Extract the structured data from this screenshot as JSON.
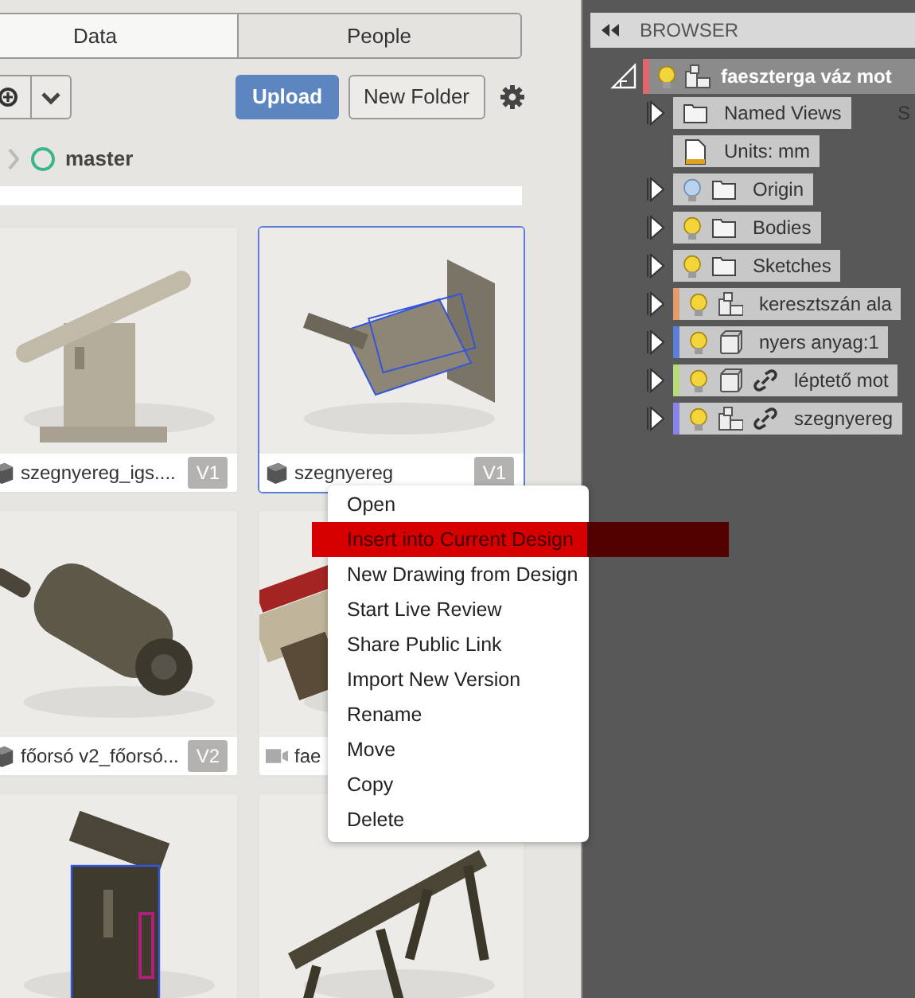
{
  "tabs": [
    {
      "label": "Data",
      "selected": true
    },
    {
      "label": "People",
      "selected": false
    }
  ],
  "toolbar": {
    "upload": "Upload",
    "new_folder": "New Folder"
  },
  "breadcrumb": {
    "branch": "master"
  },
  "cards": [
    {
      "name": "szegnyereg_igs....",
      "version": "V1",
      "kind": "design",
      "selected": false
    },
    {
      "name": "szegnyereg",
      "version": "V1",
      "kind": "design",
      "selected": true
    },
    {
      "name": "főorsó v2_főorsó...",
      "version": "V2",
      "kind": "design",
      "selected": false
    },
    {
      "name": "fae",
      "kind": "animation",
      "selected": false
    },
    {
      "selected": false
    },
    {
      "selected": false
    }
  ],
  "context_menu": [
    {
      "label": "Open",
      "selected": false
    },
    {
      "label": "Insert into Current Design",
      "selected": true
    },
    {
      "label": "New Drawing from Design",
      "selected": false
    },
    {
      "label": "Start Live Review",
      "selected": false
    },
    {
      "label": "Share Public Link",
      "selected": false
    },
    {
      "label": "Import New Version",
      "selected": false
    },
    {
      "label": "Rename",
      "selected": false
    },
    {
      "label": "Move",
      "selected": false
    },
    {
      "label": "Copy",
      "selected": false
    },
    {
      "label": "Delete",
      "selected": false
    }
  ],
  "browser": {
    "title": "BROWSER",
    "behind_text": "S",
    "root": {
      "label": "faeszterga váz mot",
      "color": "#e0666e",
      "visible": true,
      "children": [
        {
          "kind": "folder",
          "label": "Named Views",
          "expandable": true
        },
        {
          "kind": "units",
          "label": "Units: mm",
          "expandable": false
        },
        {
          "kind": "folder",
          "label": "Origin",
          "expandable": true,
          "visible": false
        },
        {
          "kind": "folder",
          "label": "Bodies",
          "expandable": true,
          "visible": true
        },
        {
          "kind": "folder",
          "label": "Sketches",
          "expandable": true,
          "visible": true
        },
        {
          "kind": "component",
          "label": "keresztszán ala",
          "expandable": true,
          "visible": true,
          "color": "#e39a6d",
          "linked": false
        },
        {
          "kind": "body",
          "label": "nyers anyag:1",
          "expandable": true,
          "visible": true,
          "color": "#5b7fd6",
          "linked": false
        },
        {
          "kind": "body",
          "label": "léptető mot",
          "expandable": true,
          "visible": true,
          "color": "#b7da7a",
          "linked": true
        },
        {
          "kind": "component",
          "label": "szegnyereg",
          "expandable": true,
          "visible": true,
          "color": "#8a84e8",
          "linked": true
        }
      ]
    }
  }
}
